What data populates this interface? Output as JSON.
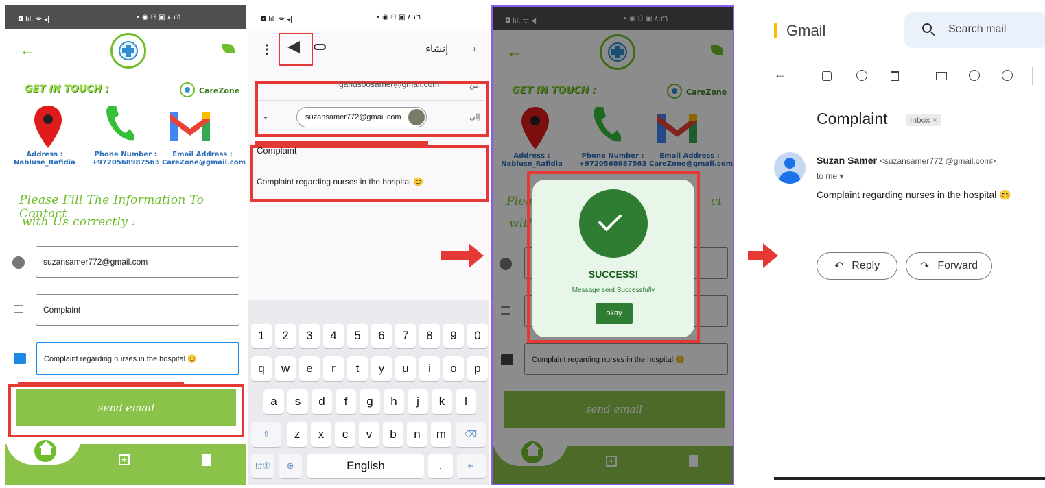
{
  "panel1": {
    "status_left": "◘ lıl. ᯤ ◂ǀ",
    "status_right": "• ◉ ⚇ ▣ ٨:٢٥",
    "get_in_touch": "GET IN TOUCH :",
    "brand": "CareZone",
    "address_label": "Address :",
    "address_value": "Nabluse_Rafidia",
    "phone_label": "Phone Number :",
    "phone_value": "+9720568987563",
    "email_label": "Email Address :",
    "email_value": "CareZone@gmail.com",
    "instructions_line1": "Please Fill  The Information To Contact",
    "instructions_line2": "with Us correctly :",
    "email_field": "suzansamer772@gmail.com",
    "subject_field": "Complaint",
    "message_field": "Complaint regarding nurses in the hospital 😊",
    "send_button": "send email"
  },
  "panel2": {
    "status_left": "◘ lıl. ᯤ ◂ǀ",
    "status_right": "• ◉ ⚇ ▣ ٨:٢٦",
    "compose_title": "إنشاء",
    "from_label": "من",
    "from_value": "gahdsoosamer@gmail.com",
    "to_label": "إلى",
    "to_chip": "suzansamer772@gmail.com",
    "subject": "Complaint",
    "body": "Complaint regarding nurses in the hospital 😊",
    "keyboard": {
      "row_numbers": [
        "1",
        "2",
        "3",
        "4",
        "5",
        "6",
        "7",
        "8",
        "9",
        "0"
      ],
      "row1": [
        "q",
        "w",
        "e",
        "r",
        "t",
        "y",
        "u",
        "i",
        "o",
        "p"
      ],
      "row2": [
        "a",
        "s",
        "d",
        "f",
        "g",
        "h",
        "j",
        "k",
        "l"
      ],
      "row3": [
        "z",
        "x",
        "c",
        "v",
        "b",
        "n",
        "m"
      ],
      "space_label": "English",
      "period": "."
    }
  },
  "panel3": {
    "status_left": "◘ lıl. ᯤ ◂ǀ",
    "status_right": "• ◉ ⚇ ▣ ٨:٢٦",
    "get_in_touch": "GET IN TOUCH :",
    "brand": "CareZone",
    "address_label": "Address :",
    "address_value": "Nabluse_Rafidia",
    "phone_label": "Phone Number :",
    "phone_value": "+9720568987563",
    "email_label": "Email Address :",
    "email_value": "CareZone@gmail.com",
    "partial_left": "Plea",
    "partial_left2": "with",
    "partial_right": "ct",
    "message_field": "Complaint regarding nurses in the hospital 😊",
    "send_button": "send email",
    "success_title": "SUCCESS!",
    "success_message": "Message sent Successfully",
    "okay_button": "okay"
  },
  "panel4": {
    "app_name": "Gmail",
    "search_placeholder": "Search mail",
    "subject": "Complaint",
    "label_chip": "Inbox ×",
    "sender_name": "Suzan Samer",
    "sender_email": "<suzansamer772 @gmail.com>",
    "recipient": "to me ▾",
    "body": "Complaint regarding nurses in the hospital 😊",
    "reply_button": "Reply",
    "forward_button": "Forward"
  },
  "colors": {
    "accent_green": "#8bc34a",
    "highlight_red": "#e53935",
    "success_green": "#2e7d32"
  }
}
